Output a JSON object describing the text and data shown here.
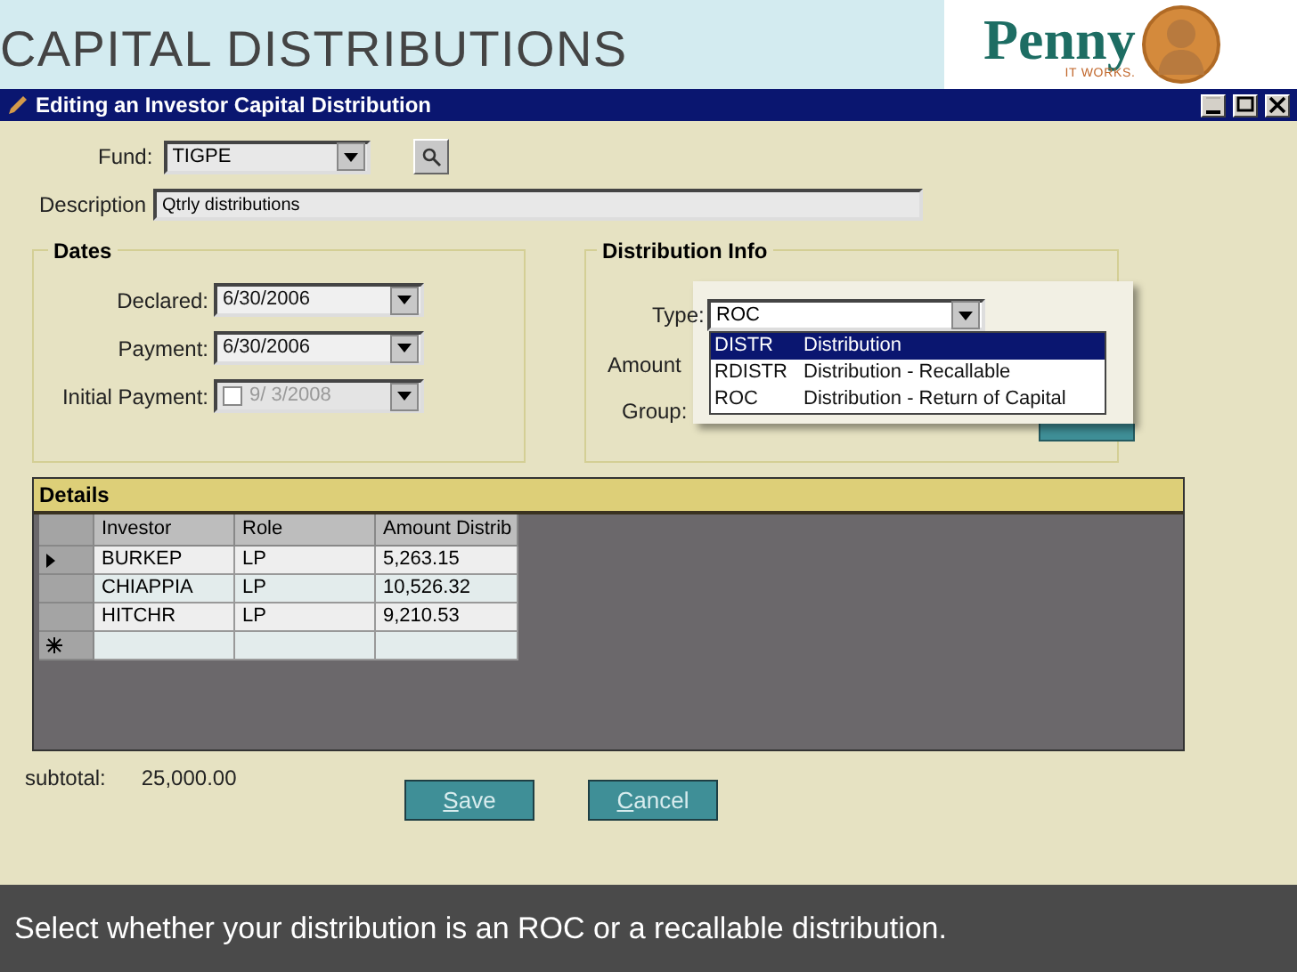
{
  "slide_title": "CAPITAL DISTRIBUTIONS",
  "logo": {
    "name": "Penny",
    "tagline": "IT WORKS."
  },
  "window": {
    "title": "Editing an Investor Capital Distribution"
  },
  "fund": {
    "label": "Fund:",
    "value": "TIGPE"
  },
  "description": {
    "label": "Description",
    "value": "Qtrly distributions"
  },
  "dates": {
    "title": "Dates",
    "fields": [
      {
        "kind": "date",
        "label": "Declared:",
        "value": "6/30/2006",
        "disabled": false
      },
      {
        "kind": "date",
        "label": "Payment:",
        "value": "6/30/2006",
        "disabled": false
      },
      {
        "kind": "optional_date",
        "label": "Initial Payment:",
        "value": "9/ 3/2008",
        "disabled": true,
        "checked": false
      }
    ]
  },
  "distribution_info": {
    "title": "Distribution Info",
    "type_label": "Type:",
    "type_value": "ROC",
    "amount_label": "Amount",
    "group_label": "Group:",
    "options": [
      {
        "code": "DISTR",
        "name": "Distribution",
        "selected": true
      },
      {
        "code": "RDISTR",
        "name": "Distribution - Recallable",
        "selected": false
      },
      {
        "code": "ROC",
        "name": "Distribution - Return of Capital",
        "selected": false
      }
    ]
  },
  "details": {
    "title": "Details",
    "columns": [
      "Investor",
      "Role",
      "Amount Distrib"
    ],
    "rows": [
      {
        "kind": "current",
        "cells": [
          "BURKEP",
          "LP",
          "5,263.15"
        ]
      },
      {
        "kind": "plain",
        "cells": [
          "CHIAPPIA",
          "LP",
          "10,526.32"
        ]
      },
      {
        "kind": "plain",
        "cells": [
          "HITCHR",
          "LP",
          "9,210.53"
        ]
      },
      {
        "kind": "new",
        "cells": [
          "",
          "",
          ""
        ]
      }
    ]
  },
  "subtotal": {
    "label": "subtotal:",
    "value": "25,000.00"
  },
  "buttons": [
    {
      "label": "Save"
    },
    {
      "label": "Cancel"
    }
  ],
  "caption": "Select whether your distribution is an ROC or a recallable distribution."
}
